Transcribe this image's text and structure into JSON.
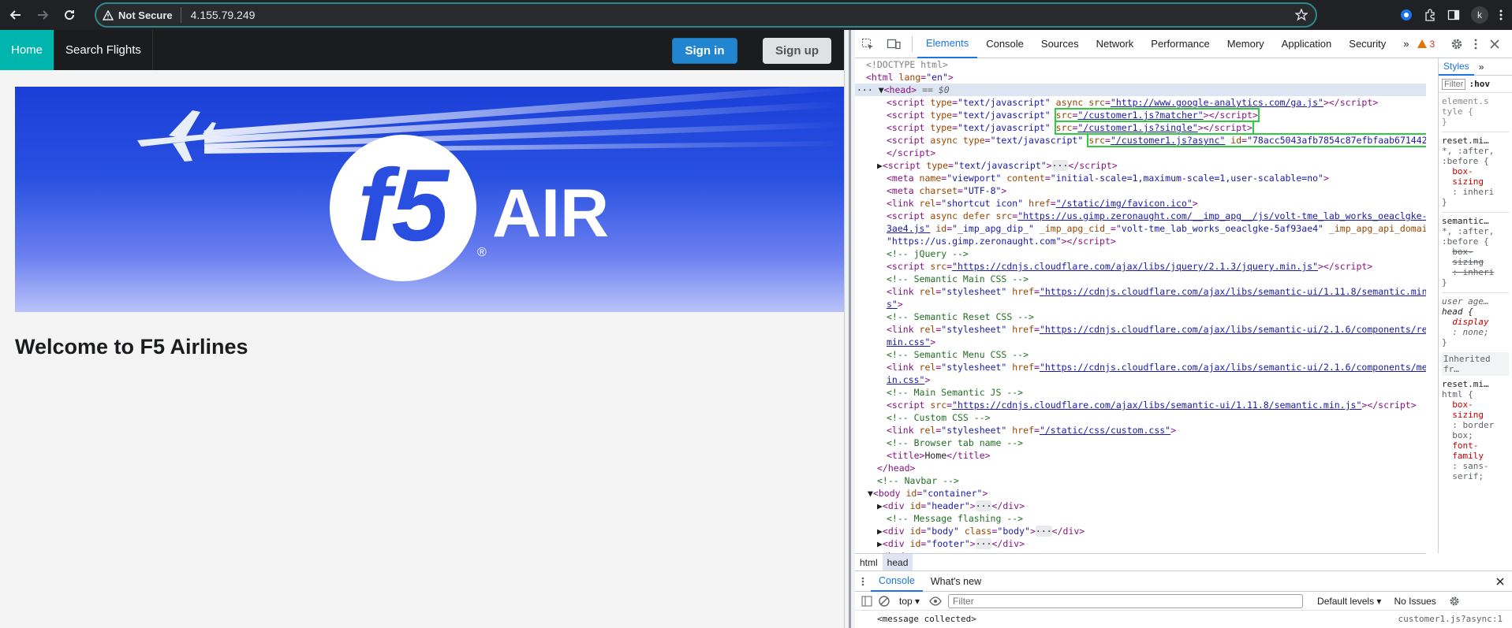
{
  "browser": {
    "security_label": "Not Secure",
    "url": "4.155.79.249",
    "profile_initial": "k"
  },
  "site": {
    "nav": [
      {
        "label": "Home",
        "active": true
      },
      {
        "label": "Search Flights",
        "active": false
      }
    ],
    "signin_label": "Sign in",
    "signup_label": "Sign up",
    "banner_logo_text": "f5",
    "banner_brand_text": "AIR",
    "banner_registered": "®",
    "welcome_heading": "Welcome to F5 Airlines"
  },
  "devtools": {
    "tabs": [
      "Elements",
      "Console",
      "Sources",
      "Network",
      "Performance",
      "Memory",
      "Application",
      "Security"
    ],
    "active_tab": "Elements",
    "more_tabs": "»",
    "warning_count": "3",
    "styles_tab": "Styles",
    "styles_more": "»",
    "styles_filter": "Filter",
    "styles_hov": ":hov",
    "breadcrumbs": [
      "html",
      "head"
    ],
    "drawer_tabs": [
      "Console",
      "What's new"
    ],
    "console_context": "top",
    "console_filter_placeholder": "Filter",
    "console_levels": "Default levels",
    "console_issues": "No Issues",
    "console_message": "<message collected>",
    "console_message_source": "customer1.js?async:1"
  }
}
